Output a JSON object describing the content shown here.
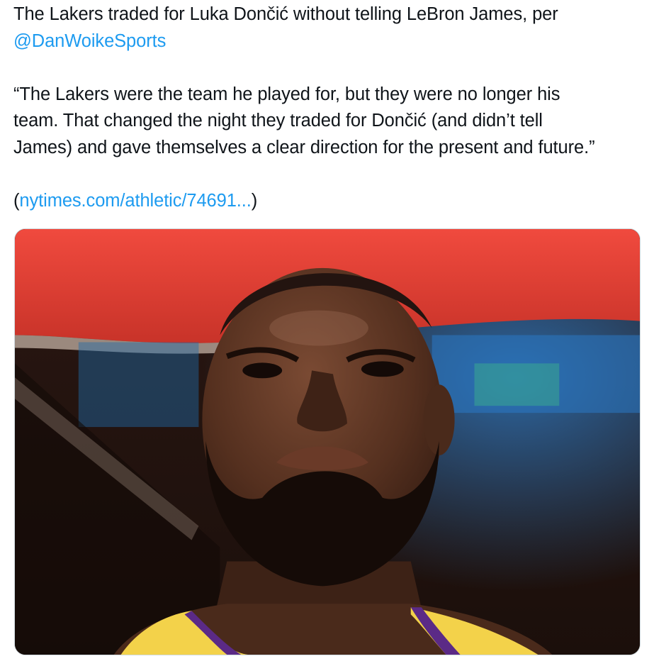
{
  "tweet": {
    "line1_text": "The Lakers traded for Luka Dončić without telling LeBron James, per",
    "mention": "@DanWoikeSports",
    "quote_line1": "“The Lakers were the team he played for, but they were no longer his",
    "quote_line2": "team. That changed the night they traded for Dončić (and didn’t tell",
    "quote_line3": "James) and gave themselves a clear direction for the present and future.”",
    "link_open": "(",
    "link_text": "nytimes.com/athletic/74691...",
    "link_close": ")"
  },
  "media": {
    "colors": {
      "banner_red": "#e8443a",
      "jersey_gold": "#f3d24a",
      "jersey_purple": "#5b2a86",
      "skin": "#5a3322",
      "link_blue": "#1d9bf0"
    }
  }
}
